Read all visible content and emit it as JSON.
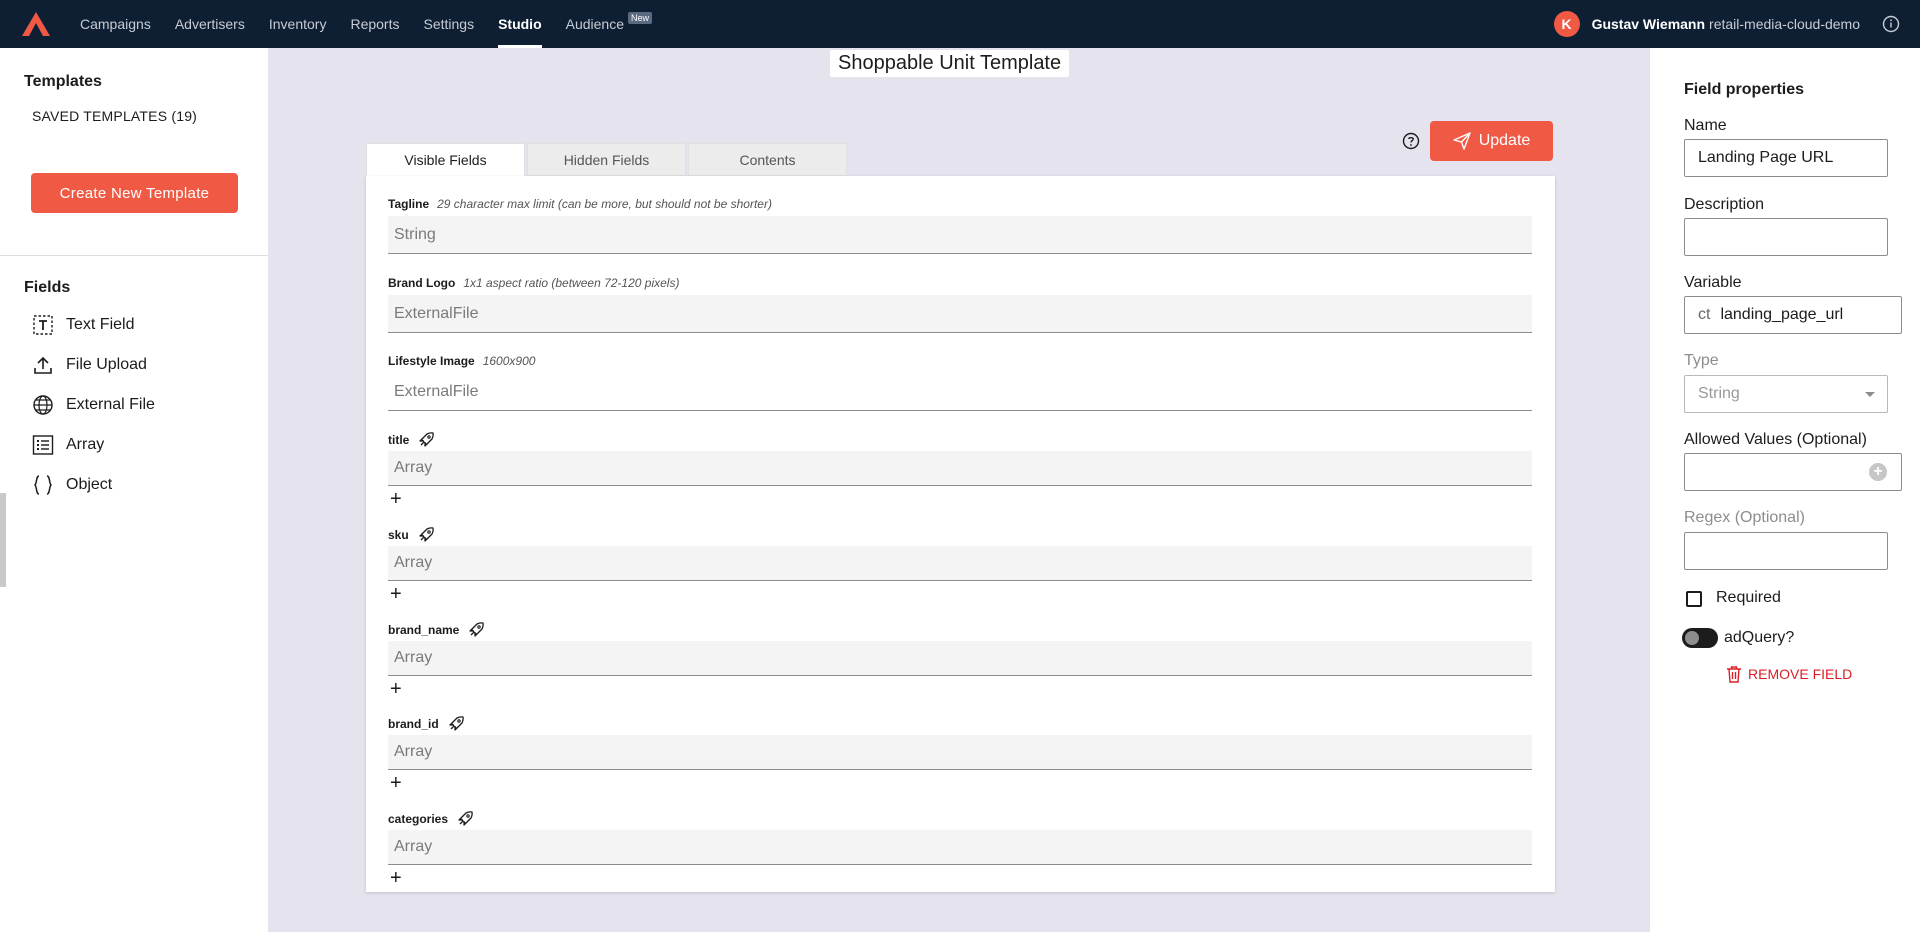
{
  "nav": {
    "items": [
      {
        "label": "Campaigns"
      },
      {
        "label": "Advertisers"
      },
      {
        "label": "Inventory"
      },
      {
        "label": "Reports"
      },
      {
        "label": "Settings"
      },
      {
        "label": "Studio",
        "active": true
      },
      {
        "label": "Audience",
        "badge": "New"
      }
    ],
    "user": {
      "initial": "K",
      "name": "Gustav Wiemann",
      "org": "retail-media-cloud-demo"
    }
  },
  "sidebar": {
    "title": "Templates",
    "saved_label": "SAVED TEMPLATES (19)",
    "create_button": "Create New Template",
    "fields_title": "Fields",
    "fields": [
      {
        "label": "Text Field",
        "icon": "text-field-icon"
      },
      {
        "label": "File Upload",
        "icon": "upload-icon"
      },
      {
        "label": "External File",
        "icon": "globe-icon"
      },
      {
        "label": "Array",
        "icon": "list-icon"
      },
      {
        "label": "Object",
        "icon": "braces-icon"
      }
    ]
  },
  "main": {
    "template_title": "Shoppable Unit Template",
    "update_label": "Update",
    "tabs": [
      {
        "label": "Visible Fields",
        "active": true
      },
      {
        "label": "Hidden Fields"
      },
      {
        "label": "Contents"
      }
    ],
    "fields": [
      {
        "name": "Tagline",
        "hint": "29 character max limit (can be more, but should not be shorter)",
        "type": "String"
      },
      {
        "name": "Brand Logo",
        "hint": "1x1 aspect ratio (between 72-120 pixels)",
        "type": "ExternalFile"
      },
      {
        "name": "Lifestyle Image",
        "hint": "1600x900",
        "type": "ExternalFile"
      },
      {
        "name": "title",
        "type": "Array",
        "adquery": true
      },
      {
        "name": "sku",
        "type": "Array",
        "adquery": true
      },
      {
        "name": "brand_name",
        "type": "Array",
        "adquery": true
      },
      {
        "name": "brand_id",
        "type": "Array",
        "adquery": true
      },
      {
        "name": "categories",
        "type": "Array",
        "adquery": true
      }
    ],
    "plus_glyph": "+"
  },
  "properties": {
    "title": "Field properties",
    "name_label": "Name",
    "name_value": "Landing Page URL",
    "description_label": "Description",
    "description_value": "",
    "variable_label": "Variable",
    "variable_prefix": "ct",
    "variable_value": "landing_page_url",
    "type_label": "Type",
    "type_value": "String",
    "allowed_label": "Allowed Values (Optional)",
    "regex_label": "Regex (Optional)",
    "required_label": "Required",
    "required_checked": false,
    "adquery_label": "adQuery?",
    "adquery_on": false,
    "remove_label": "REMOVE FIELD"
  },
  "colors": {
    "accent": "#f05a45",
    "nav_bg": "#0f1f33",
    "canvas_bg": "#e4e3ee",
    "danger": "#da1e28"
  }
}
